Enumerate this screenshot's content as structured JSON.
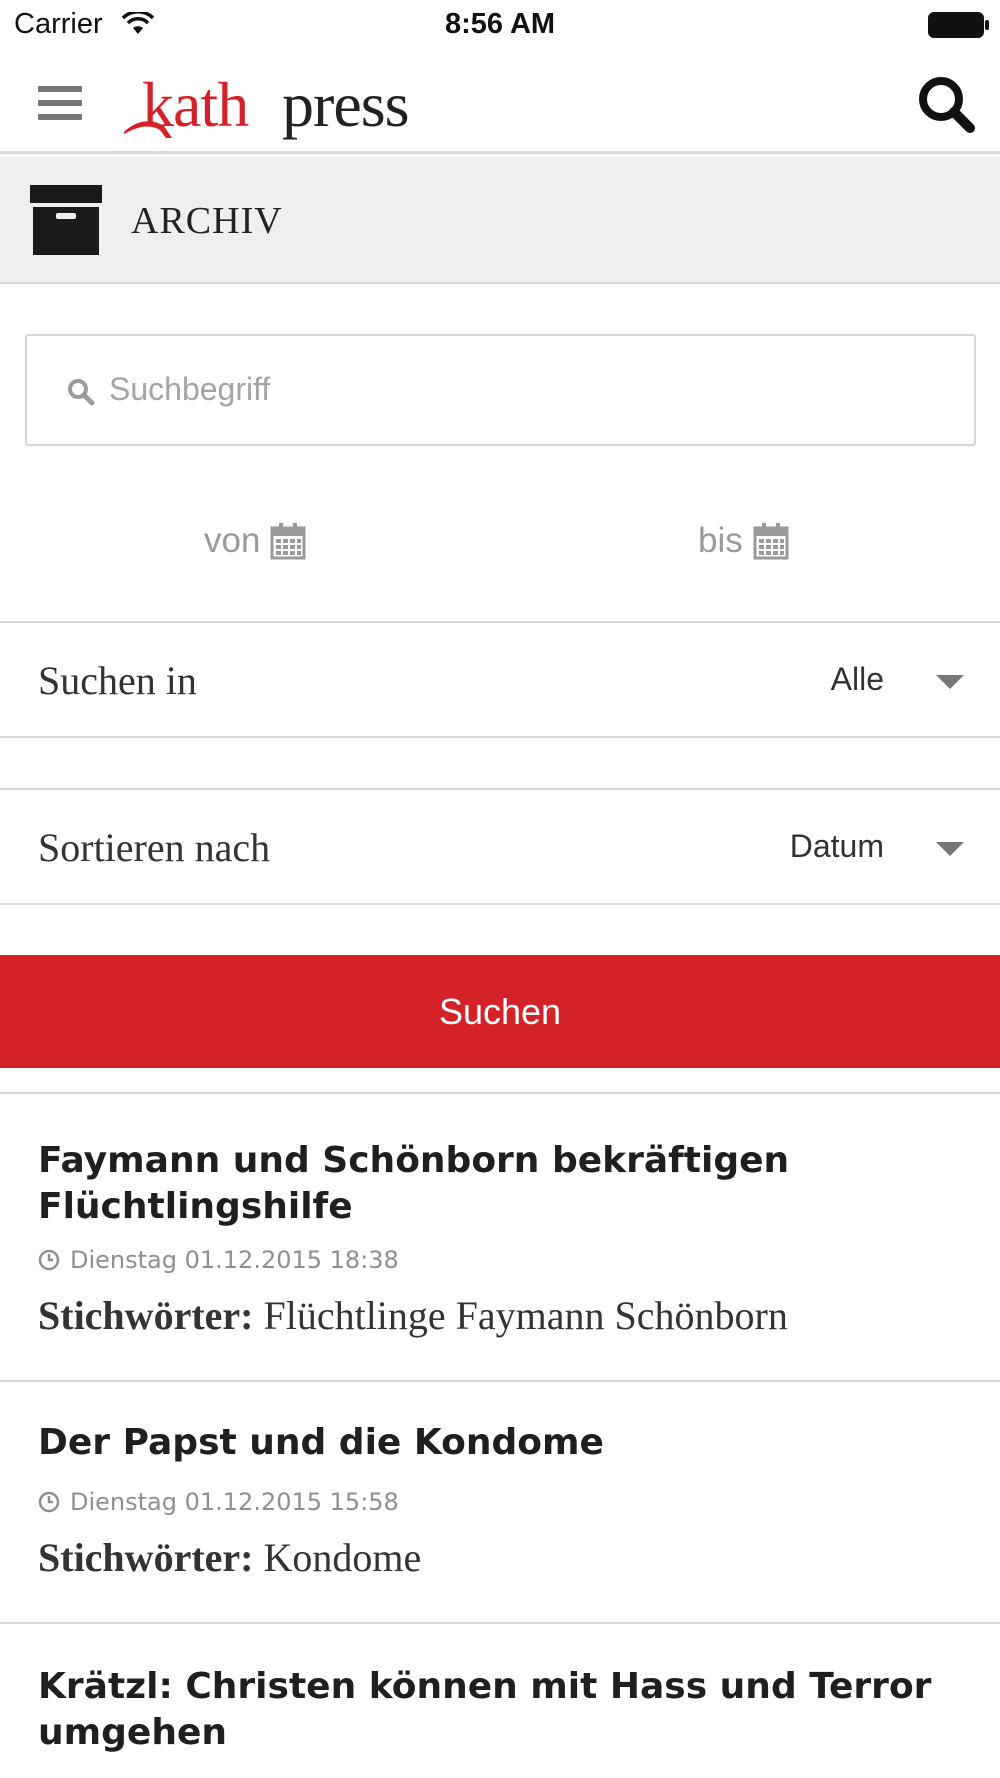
{
  "status_bar": {
    "carrier": "Carrier",
    "time": "8:56 AM"
  },
  "header": {
    "logo_part1": "kath",
    "logo_part2": "press",
    "brand_color": "#d32228",
    "menu_icon": "hamburger-menu-icon",
    "search_icon": "search-icon"
  },
  "section": {
    "title": "ARCHIV",
    "icon": "archive-box-icon"
  },
  "search": {
    "placeholder": "Suchbegriff",
    "value": ""
  },
  "dates": {
    "from_label": "von",
    "to_label": "bis"
  },
  "filters": {
    "search_in_label": "Suchen in",
    "search_in_value": "Alle",
    "sort_label": "Sortieren nach",
    "sort_value": "Datum"
  },
  "submit": {
    "label": "Suchen"
  },
  "results": [
    {
      "title": "Faymann und Schönborn bekräftigen Flüchtlingshilfe",
      "date": "Dienstag 01.12.2015 18:38",
      "tags_label": "Stichwörter:",
      "tags": "Flüchtlinge Faymann Schönborn"
    },
    {
      "title": "Der Papst und die Kondome",
      "date": "Dienstag 01.12.2015 15:58",
      "tags_label": "Stichwörter:",
      "tags": "Kondome"
    },
    {
      "title": "Krätzl: Christen können mit Hass und Terror umgehen"
    }
  ]
}
